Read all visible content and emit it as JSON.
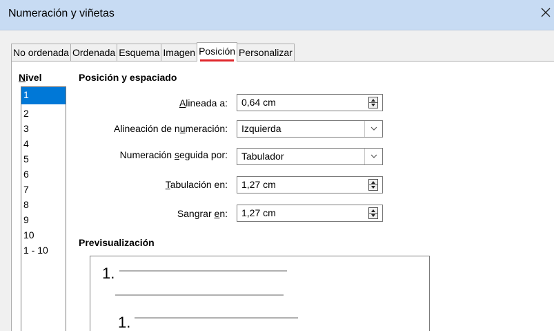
{
  "window": {
    "title": "Numeración y viñetas",
    "close_icon": "close-icon"
  },
  "tabs": [
    {
      "label": "No ordenada",
      "active": false
    },
    {
      "label": "Ordenada",
      "active": false
    },
    {
      "label": "Esquema",
      "active": false
    },
    {
      "label": "Imagen",
      "active": false
    },
    {
      "label": "Posición",
      "active": true
    },
    {
      "label": "Personalizar",
      "active": false
    }
  ],
  "level": {
    "heading_accel": "N",
    "heading_rest": "ivel",
    "items": [
      "1",
      "2",
      "3",
      "4",
      "5",
      "6",
      "7",
      "8",
      "9",
      "10",
      "1 - 10"
    ],
    "selected": "1"
  },
  "position": {
    "section_title": "Posición y espaciado",
    "aligned_at": {
      "label_accel": "A",
      "label_rest": "lineada a:",
      "value": "0,64 cm"
    },
    "numbering_alignment": {
      "label_pre": "Alineación de n",
      "label_accel": "u",
      "label_post": "meración:",
      "value": "Izquierda"
    },
    "numbering_followed_by": {
      "label_pre": "Numeración ",
      "label_accel": "s",
      "label_post": "eguida por:",
      "value": "Tabulador"
    },
    "tab_stop_at": {
      "label_accel": "T",
      "label_rest": "abulación en:",
      "value": "1,27 cm"
    },
    "indent_at": {
      "label_pre": "Sangrar ",
      "label_accel": "e",
      "label_post": "n:",
      "value": "1,27 cm"
    }
  },
  "preview": {
    "title": "Previsualización",
    "numbers": [
      "1.",
      "1."
    ]
  },
  "colors": {
    "titlebar": "#c7dbf3",
    "selection": "#0078d7",
    "active_tab_underline": "#e0262b"
  }
}
